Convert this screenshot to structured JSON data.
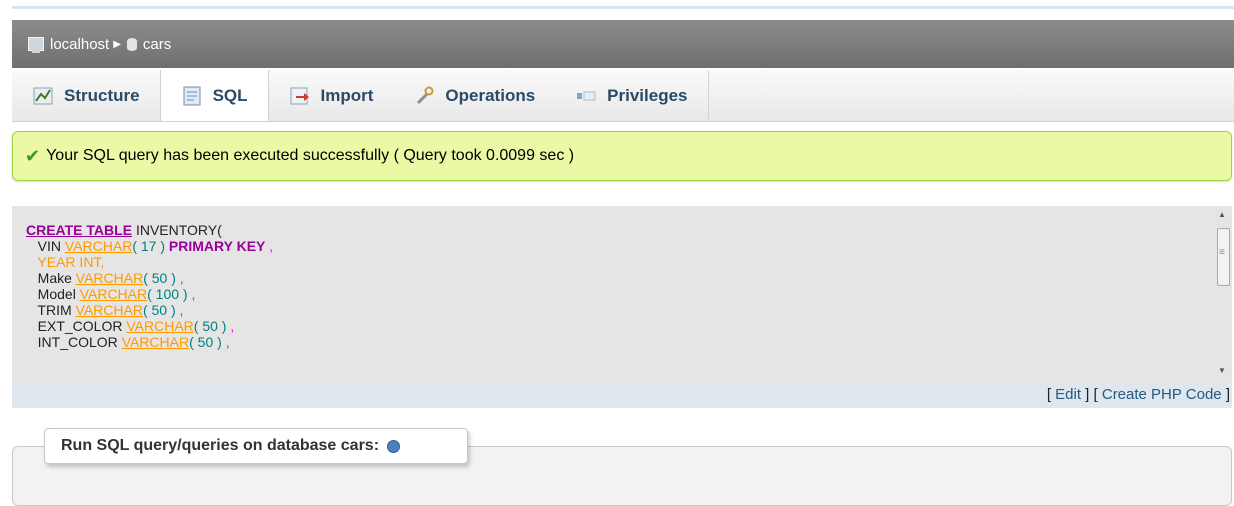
{
  "breadcrumb": {
    "server": "localhost",
    "server_icon": "server-icon",
    "database": "cars",
    "database_icon": "database-icon"
  },
  "tabs": [
    {
      "label": "Structure",
      "icon": "structure-icon"
    },
    {
      "label": "SQL",
      "icon": "sql-icon"
    },
    {
      "label": "Import",
      "icon": "import-icon"
    },
    {
      "label": "Operations",
      "icon": "wrench-icon"
    },
    {
      "label": "Privileges",
      "icon": "privileges-icon"
    }
  ],
  "message": {
    "text": "Your SQL query has been executed successfully ( Query took 0.0099 sec )",
    "icon": "check-icon"
  },
  "sql": {
    "l1_kw": "CREATE TABLE",
    "l1_name": "INVENTORY(",
    "l2_col": "VIN",
    "l2_type": "VARCHAR",
    "l2_args": "( 17 )",
    "l2_pk": "PRIMARY KEY",
    "l3": "YEAR INT,",
    "l4_col": "Make",
    "l4_type": "VARCHAR",
    "l4_args": "( 50 )",
    "l5_col": "Model",
    "l5_type": "VARCHAR",
    "l5_args": "( 100 )",
    "l6_col": "TRIM",
    "l6_type": "VARCHAR",
    "l6_args": "( 50 )",
    "l7_col": "EXT_COLOR",
    "l7_type": "VARCHAR",
    "l7_args": "( 50 )",
    "l8_col": "INT_COLOR",
    "l8_type": "VARCHAR",
    "l8_args": "( 50 )"
  },
  "actions": {
    "edit": "Edit",
    "create_php": "Create PHP Code"
  },
  "query_panel": {
    "legend_prefix": "Run SQL query/queries on database ",
    "database": "cars:",
    "help_icon": "help-icon"
  }
}
